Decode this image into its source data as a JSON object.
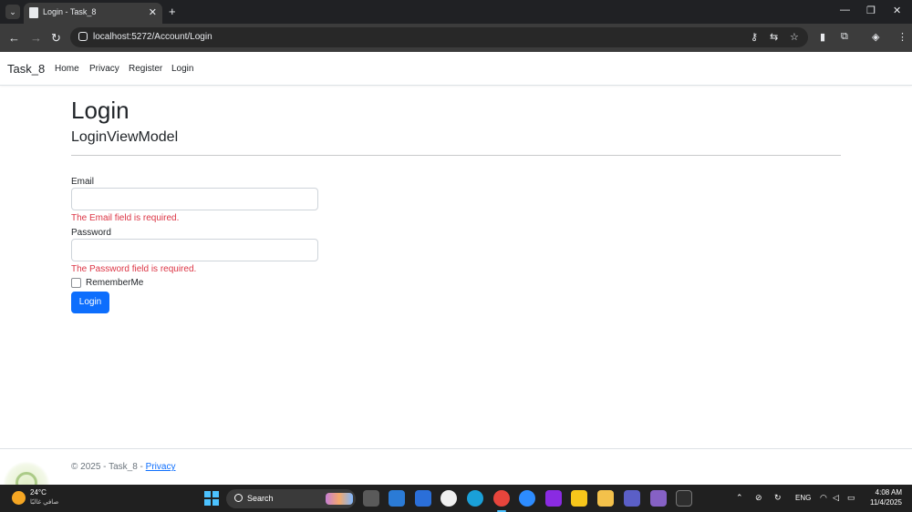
{
  "browser": {
    "tab_title": "Login - Task_8",
    "tab_close": "✕",
    "new_tab": "+",
    "url": "localhost:5272/Account/Login",
    "window_controls": {
      "minimize": "—",
      "maximize": "❐",
      "close": "✕"
    }
  },
  "navbar": {
    "brand": "Task_8",
    "links": [
      "Home",
      "Privacy",
      "Register",
      "Login"
    ]
  },
  "page": {
    "title": "Login",
    "subtitle": "LoginViewModel"
  },
  "form": {
    "email_label": "Email",
    "email_value": "",
    "email_error": "The Email field is required.",
    "password_label": "Password",
    "password_value": "",
    "password_error": "The Password field is required.",
    "remember_label": "RememberMe",
    "remember_checked": false,
    "submit_label": "Login"
  },
  "footer": {
    "text": "© 2025 - Task_8 - ",
    "link": "Privacy"
  },
  "taskbar": {
    "weather_temp": "24°C",
    "weather_desc": "صافي غالبًا",
    "search_text": "Search",
    "language": "ENG",
    "time": "4:08 AM",
    "date": "11/4/2025"
  },
  "colors": {
    "primary": "#0d6efd",
    "danger": "#dc3545",
    "chrome_dark": "#202124",
    "chrome_toolbar": "#3c3c3c"
  }
}
